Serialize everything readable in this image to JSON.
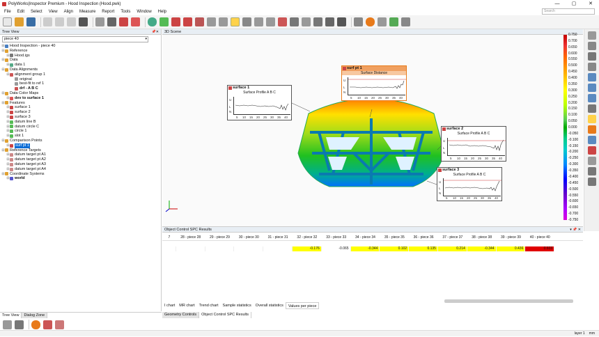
{
  "window": {
    "title": "PolyWorks|Inspector Premium - Hood Inspection (Hood.pwk)",
    "min": "—",
    "max": "▢",
    "close": "✕"
  },
  "menu": [
    "File",
    "Edit",
    "Select",
    "View",
    "Align",
    "Measure",
    "Report",
    "Tools",
    "Window",
    "Help"
  ],
  "search": {
    "placeholder": "Search"
  },
  "tree_view": {
    "title": "Tree View",
    "filter_value": "piece 40",
    "items": [
      {
        "label": "Hood Inspection - piece 40",
        "level": 0,
        "icon": "project-icon",
        "color": "#4a7fc1"
      },
      {
        "label": "Reference",
        "level": 0,
        "icon": "folder-icon",
        "color": "#e0a030"
      },
      {
        "label": "Hood.igs",
        "level": 1,
        "icon": "cad-icon",
        "color": "#777"
      },
      {
        "label": "Data",
        "level": 0,
        "icon": "folder-icon",
        "color": "#e0a030"
      },
      {
        "label": "data 1",
        "level": 1,
        "icon": "data-icon",
        "color": "#5a8"
      },
      {
        "label": "Data Alignments",
        "level": 0,
        "icon": "folder-icon",
        "color": "#e0a030"
      },
      {
        "label": "alignment group 1",
        "level": 1,
        "icon": "alignment-icon",
        "color": "#c55"
      },
      {
        "label": "original",
        "level": 2,
        "icon": "alignment-icon",
        "color": "#999"
      },
      {
        "label": "best-fit to ref 1",
        "level": 2,
        "icon": "alignment-icon",
        "color": "#999"
      },
      {
        "label": "drf - A B C",
        "level": 2,
        "icon": "alignment-icon",
        "color": "#c55",
        "bold": true
      },
      {
        "label": "Data Color Maps",
        "level": 0,
        "icon": "folder-icon",
        "color": "#e0a030"
      },
      {
        "label": "dev to surface 1",
        "level": 1,
        "icon": "colormap-icon",
        "color": "#d55",
        "bold": true
      },
      {
        "label": "Features",
        "level": 0,
        "icon": "folder-icon",
        "color": "#e0a030"
      },
      {
        "label": "surface 1",
        "level": 1,
        "icon": "surface-icon",
        "color": "#c44"
      },
      {
        "label": "surface 2",
        "level": 1,
        "icon": "surface-icon",
        "color": "#c44"
      },
      {
        "label": "surface 3",
        "level": 1,
        "icon": "surface-icon",
        "color": "#c44"
      },
      {
        "label": "datum line B",
        "level": 1,
        "icon": "datum-icon",
        "color": "#5b5"
      },
      {
        "label": "datum circle C",
        "level": 1,
        "icon": "datum-icon",
        "color": "#5b5"
      },
      {
        "label": "circle 1",
        "level": 1,
        "icon": "circle-icon",
        "color": "#5b5"
      },
      {
        "label": "slot 1",
        "level": 1,
        "icon": "slot-icon",
        "color": "#5b5"
      },
      {
        "label": "Comparison Points",
        "level": 0,
        "icon": "folder-icon",
        "color": "#e0a030"
      },
      {
        "label": "surf pt 1",
        "level": 1,
        "icon": "point-icon",
        "color": "#c44",
        "selected": true
      },
      {
        "label": "Reference Targets",
        "level": 0,
        "icon": "folder-icon",
        "color": "#e0a030"
      },
      {
        "label": "datum target pt A1",
        "level": 1,
        "icon": "target-icon",
        "color": "#c88"
      },
      {
        "label": "datum target pt A2",
        "level": 1,
        "icon": "target-icon",
        "color": "#c88"
      },
      {
        "label": "datum target pt A3",
        "level": 1,
        "icon": "target-icon",
        "color": "#c88"
      },
      {
        "label": "datum target pt A4",
        "level": 1,
        "icon": "target-icon",
        "color": "#c88"
      },
      {
        "label": "Coordinate Systems",
        "level": 0,
        "icon": "folder-icon",
        "color": "#e0a030"
      },
      {
        "label": "world",
        "level": 1,
        "icon": "axes-icon",
        "color": "#55c",
        "bold": true
      }
    ]
  },
  "left_tabs": [
    "Tree View",
    "Dialog Zone"
  ],
  "scene": {
    "title": "3D Scene",
    "colorbar_labels": [
      "0.750",
      "0.700",
      "0.650",
      "0.600",
      "0.550",
      "0.500",
      "0.450",
      "0.400",
      "0.350",
      "0.300",
      "0.250",
      "0.200",
      "0.150",
      "0.100",
      "0.050",
      "0.000",
      "-0.050",
      "-0.100",
      "-0.150",
      "-0.200",
      "-0.250",
      "-0.300",
      "-0.350",
      "-0.400",
      "-0.450",
      "-0.500",
      "-0.550",
      "-0.600",
      "-0.650",
      "-0.700",
      "-0.750"
    ],
    "callouts": [
      {
        "title": "surface 1",
        "subtitle": "Surface Profile A B C",
        "u": "U",
        "l": "L",
        "n": "N",
        "xticks": [
          "5",
          "10",
          "15",
          "20",
          "25",
          "30",
          "35",
          "40"
        ],
        "highlight": false
      },
      {
        "title": "surf pt 1",
        "subtitle": "Surface Distance",
        "u": "U",
        "l": "L",
        "n": "N",
        "xticks": [
          "5",
          "10",
          "15",
          "20",
          "25",
          "30",
          "35",
          "40"
        ],
        "highlight": true
      },
      {
        "title": "surface 2",
        "subtitle": "Surface Profile A B C",
        "u": "U",
        "l": "L",
        "n": "N",
        "xticks": [
          "5",
          "10",
          "15",
          "20",
          "25",
          "30",
          "35",
          "40"
        ],
        "highlight": false
      },
      {
        "title": "surface 3",
        "subtitle": "Surface Profile A B C",
        "u": "U",
        "l": "L",
        "n": "N",
        "xticks": [
          "5",
          "10",
          "15",
          "20",
          "25",
          "30",
          "35",
          "40"
        ],
        "highlight": false
      }
    ]
  },
  "spc": {
    "title": "Object Control SPC Results",
    "columns": [
      "7",
      "28 - piece 28",
      "29 - piece 29",
      "30 - piece 30",
      "31 - piece 31",
      "32 - piece 32",
      "33 - piece 33",
      "34 - piece 34",
      "35 - piece 35",
      "36 - piece 36",
      "37 - piece 37",
      "38 - piece 38",
      "39 - piece 39",
      "40 - piece 40"
    ],
    "values": [
      "",
      "",
      "",
      "",
      "",
      "-0.176",
      "-0.065",
      "-0.344",
      "0.102",
      "0.135",
      "0.214",
      "-0.344",
      "0.436",
      "0.603"
    ],
    "value_colors": [
      "#fff",
      "#fff",
      "#fff",
      "#fff",
      "#fff",
      "#ffff00",
      "#fff",
      "#ffff00",
      "#ffff00",
      "#ffff00",
      "#ffff00",
      "#ffff00",
      "#ffff00",
      "#e00000"
    ],
    "tabs": [
      "I chart",
      "MR chart",
      "Trend chart",
      "Sample statistics",
      "Overall statistics",
      "Values per piece"
    ]
  },
  "bottom_tabs": [
    "Geometry Controls",
    "Object Control SPC Results"
  ],
  "status": {
    "layer": "layer 1",
    "units": "mm"
  }
}
